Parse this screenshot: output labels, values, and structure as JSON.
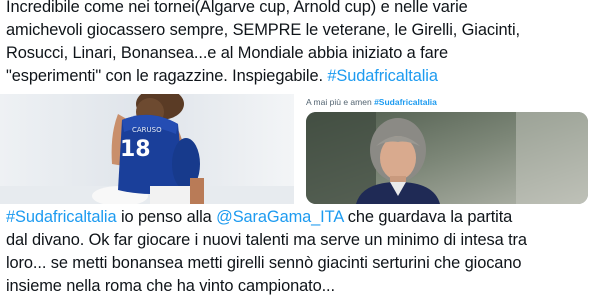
{
  "tweet_top": {
    "lines": [
      "Incredibile come nei tornei(Algarve cup, Arnold cup) e nelle varie",
      "amichevoli giocassero sempre, SEMPRE le veterane, le Girelli, Giacinti,",
      "Rosucci, Linari, Bonansea...e al Mondiale abbia iniziato a fare",
      "\"esperimenti\" con le ragazzine. Inspiegabile."
    ],
    "hashtag": "#Sudafricaltalia"
  },
  "quoted_tweet": {
    "caption_text": "A mai più e amen",
    "caption_hashtag": "#Sudafricaltalia"
  },
  "left_photo": {
    "jersey_name": "CARUSO",
    "jersey_number": "18"
  },
  "tweet_bottom": {
    "hashtag": "#Sudafricaltalia",
    "line1_a": "io penso alla",
    "mention": "@SaraGama_ITA",
    "line1_b": "che guardava la partita",
    "lines": [
      "dal divano. Ok far giocare i nuovi talenti ma serve un minimo di intesa tra",
      "loro... se metti bonansea metti girelli sennò giacinti serturini che giocano",
      "insieme nella roma che ha vinto campionato..."
    ]
  },
  "colors": {
    "link": "#1d9bf0",
    "text": "#0f1419",
    "italy_blue": "#1a3f9a"
  }
}
